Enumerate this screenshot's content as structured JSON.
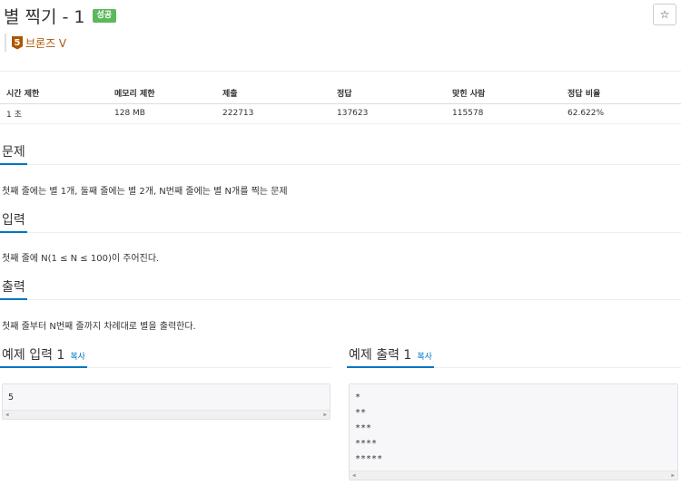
{
  "problem": {
    "title": "별 찍기 - 1",
    "result_badge": "성공",
    "star_icon": "☆",
    "tier": {
      "number": "5",
      "label": "브론즈 V",
      "color": "#ad5600"
    }
  },
  "info_table": {
    "headers": [
      "시간 제한",
      "메모리 제한",
      "제출",
      "정답",
      "맞힌 사람",
      "정답 비율"
    ],
    "values": [
      "1 초",
      "128 MB",
      "222713",
      "137623",
      "115578",
      "62.622%"
    ]
  },
  "sections": {
    "description": {
      "heading": "문제",
      "text": "첫째 줄에는 별 1개, 둘째 줄에는 별 2개, N번째 줄에는 별 N개를 찍는 문제"
    },
    "input": {
      "heading": "입력",
      "text": "첫째 줄에 N(1 ≤ N ≤ 100)이 주어진다."
    },
    "output": {
      "heading": "출력",
      "text": "첫째 줄부터 N번째 줄까지 차례대로 별을 출력한다."
    }
  },
  "examples": {
    "input": {
      "heading": "예제 입력 1",
      "copy_label": "복사",
      "lines": [
        "5"
      ]
    },
    "output": {
      "heading": "예제 출력 1",
      "copy_label": "복사",
      "lines": [
        "*",
        "**",
        "***",
        "****",
        "*****"
      ]
    }
  },
  "colors": {
    "accent": "#0076c0",
    "success": "#5cb85c",
    "bronze": "#ad5600"
  }
}
